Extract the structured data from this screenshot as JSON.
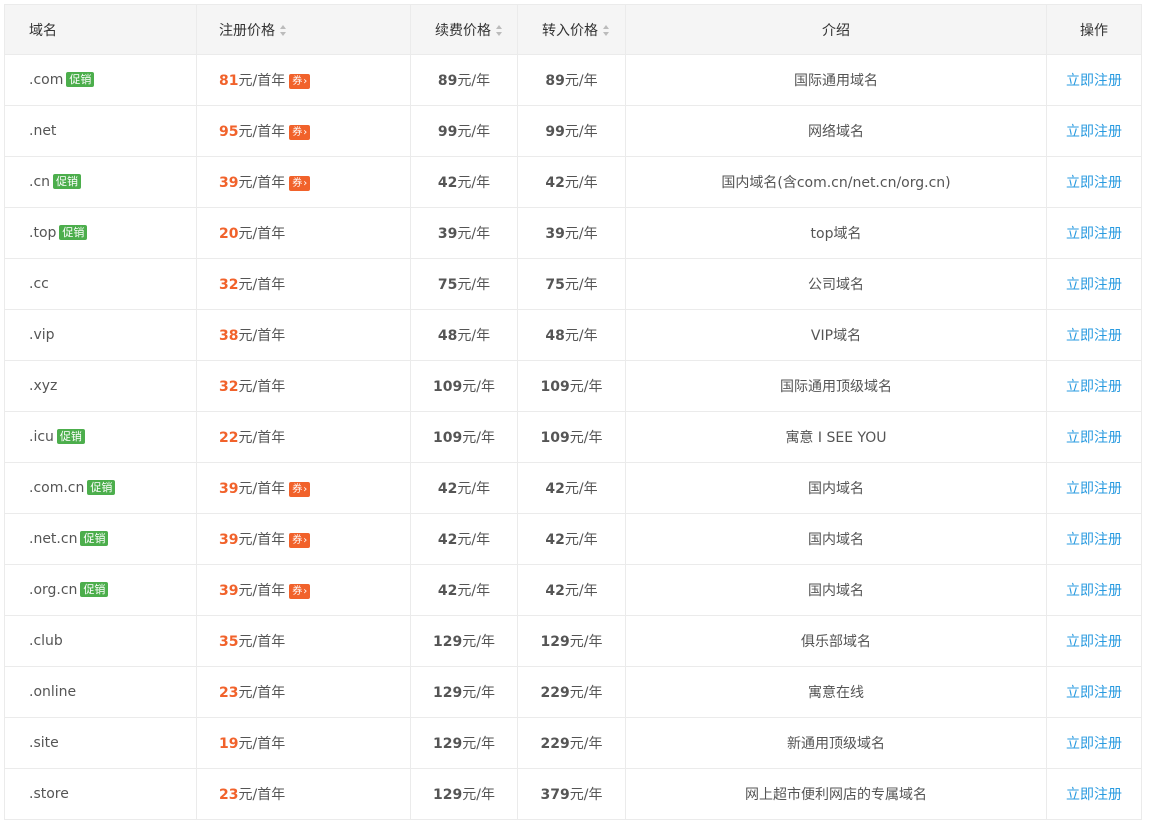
{
  "header": {
    "domain": "域名",
    "register_price": "注册价格",
    "renew_price": "续费价格",
    "transfer_price": "转入价格",
    "description": "介绍",
    "action": "操作"
  },
  "labels": {
    "promo": "促销",
    "coupon": "券",
    "coupon_arrow": "›",
    "first_year_unit": "元/首年",
    "year_unit": "元/年",
    "register_now": "立即注册"
  },
  "rows": [
    {
      "domain": ".com",
      "promo": true,
      "reg": "81",
      "coupon": true,
      "renew": "89",
      "transfer": "89",
      "desc": "国际通用域名"
    },
    {
      "domain": ".net",
      "promo": false,
      "reg": "95",
      "coupon": true,
      "renew": "99",
      "transfer": "99",
      "desc": "网络域名"
    },
    {
      "domain": ".cn",
      "promo": true,
      "reg": "39",
      "coupon": true,
      "renew": "42",
      "transfer": "42",
      "desc": "国内域名(含com.cn/net.cn/org.cn)"
    },
    {
      "domain": ".top",
      "promo": true,
      "reg": "20",
      "coupon": false,
      "renew": "39",
      "transfer": "39",
      "desc": "top域名"
    },
    {
      "domain": ".cc",
      "promo": false,
      "reg": "32",
      "coupon": false,
      "renew": "75",
      "transfer": "75",
      "desc": "公司域名"
    },
    {
      "domain": ".vip",
      "promo": false,
      "reg": "38",
      "coupon": false,
      "renew": "48",
      "transfer": "48",
      "desc": "VIP域名"
    },
    {
      "domain": ".xyz",
      "promo": false,
      "reg": "32",
      "coupon": false,
      "renew": "109",
      "transfer": "109",
      "desc": "国际通用顶级域名"
    },
    {
      "domain": ".icu",
      "promo": true,
      "reg": "22",
      "coupon": false,
      "renew": "109",
      "transfer": "109",
      "desc": "寓意 I SEE YOU"
    },
    {
      "domain": ".com.cn",
      "promo": true,
      "reg": "39",
      "coupon": true,
      "renew": "42",
      "transfer": "42",
      "desc": "国内域名"
    },
    {
      "domain": ".net.cn",
      "promo": true,
      "reg": "39",
      "coupon": true,
      "renew": "42",
      "transfer": "42",
      "desc": "国内域名"
    },
    {
      "domain": ".org.cn",
      "promo": true,
      "reg": "39",
      "coupon": true,
      "renew": "42",
      "transfer": "42",
      "desc": "国内域名"
    },
    {
      "domain": ".club",
      "promo": false,
      "reg": "35",
      "coupon": false,
      "renew": "129",
      "transfer": "129",
      "desc": "俱乐部域名"
    },
    {
      "domain": ".online",
      "promo": false,
      "reg": "23",
      "coupon": false,
      "renew": "129",
      "transfer": "229",
      "desc": "寓意在线"
    },
    {
      "domain": ".site",
      "promo": false,
      "reg": "19",
      "coupon": false,
      "renew": "129",
      "transfer": "229",
      "desc": "新通用顶级域名"
    },
    {
      "domain": ".store",
      "promo": false,
      "reg": "23",
      "coupon": false,
      "renew": "129",
      "transfer": "379",
      "desc": "网上超市便利网店的专属域名"
    }
  ],
  "colors": {
    "accent_price": "#f1622b",
    "promo_badge": "#4cae4c",
    "link": "#2a9be0",
    "header_bg": "#f5f5f5"
  },
  "icons": {
    "sort": "sort-icon"
  }
}
